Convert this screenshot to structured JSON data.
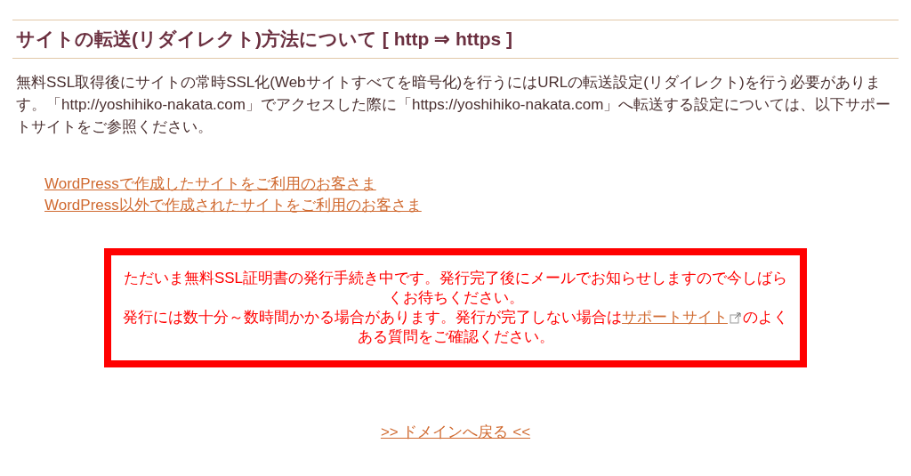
{
  "heading": "サイトの転送(リダイレクト)方法について [ http ⇒ https ]",
  "intro": "無料SSL取得後にサイトの常時SSL化(Webサイトすべてを暗号化)を行うにはURLの転送設定(リダイレクト)を行う必要があります。「http://yoshihiko-nakata.com」でアクセスした際に「https://yoshihiko-nakata.com」へ転送する設定については、以下サポートサイトをご参照ください。",
  "links": [
    "WordPressで作成したサイトをご利用のお客さま",
    "WordPress以外で作成されたサイトをご利用のお客さま"
  ],
  "notice": {
    "line_1": "ただいま無料SSL証明書の発行手続き中です。発行完了後にメールでお知らせしますので今しばらくお待ちください。",
    "line_2_before": "発行には数十分～数時間かかる場合があります。発行が完了しない場合は",
    "link": "サポートサイト",
    "line_2_after": "のよくある質問をご確認ください。"
  },
  "back_link": ">> ドメインへ戻る <<"
}
